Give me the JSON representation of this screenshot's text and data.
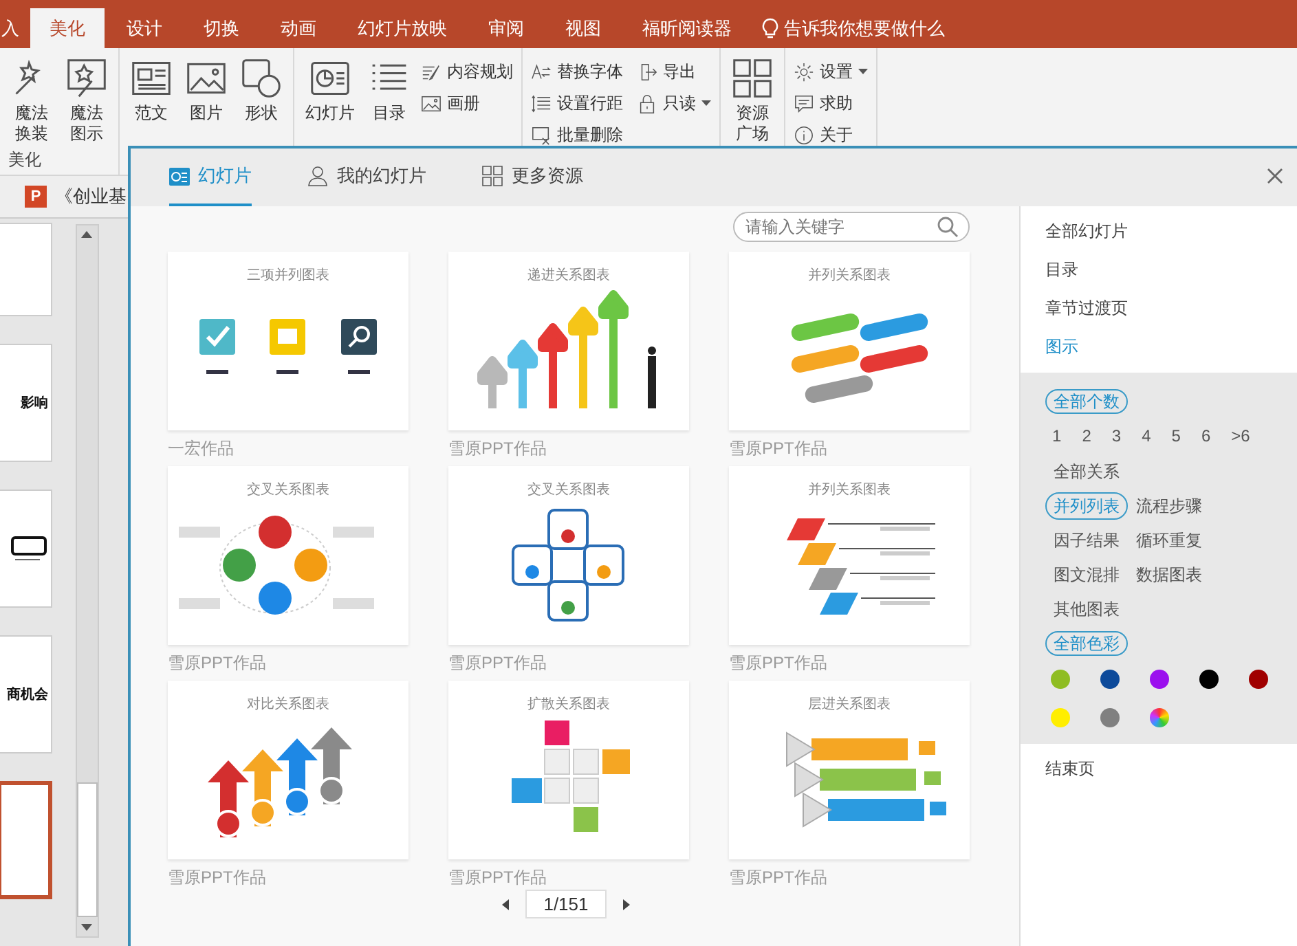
{
  "ribbon_tabs": [
    {
      "label": "入",
      "selected": false
    },
    {
      "label": "美化",
      "selected": true
    },
    {
      "label": "设计",
      "selected": false
    },
    {
      "label": "切换",
      "selected": false
    },
    {
      "label": "动画",
      "selected": false
    },
    {
      "label": "幻灯片放映",
      "selected": false
    },
    {
      "label": "审阅",
      "selected": false
    },
    {
      "label": "视图",
      "selected": false
    },
    {
      "label": "福昕阅读器",
      "selected": false
    }
  ],
  "tell_me": "告诉我你想要做什么",
  "ribbon_groups": [
    {
      "label": "美化",
      "large": [
        {
          "label": "魔法换装",
          "kind": "wand"
        },
        {
          "label": "魔法图示",
          "kind": "wandframe"
        }
      ]
    },
    {
      "large": [
        {
          "label": "范文",
          "kind": "doc"
        },
        {
          "label": "图片",
          "kind": "picture"
        },
        {
          "label": "形状",
          "kind": "shapes"
        }
      ]
    },
    {
      "large": [
        {
          "label": "幻灯片",
          "kind": "slide"
        },
        {
          "label": "目录",
          "kind": "list"
        }
      ],
      "small": [
        {
          "label": "内容规划",
          "kind": "pen",
          "dropdown": false
        },
        {
          "label": "画册",
          "kind": "album",
          "dropdown": false
        }
      ]
    },
    {
      "small": [
        {
          "label": "替换字体",
          "kind": "font",
          "dropdown": false
        },
        {
          "label": "设置行距",
          "kind": "spacing",
          "dropdown": false
        },
        {
          "label": "批量删除",
          "kind": "delete",
          "dropdown": false
        },
        {
          "label": "导出",
          "kind": "export",
          "dropdown": false
        },
        {
          "label": "只读",
          "kind": "lock",
          "dropdown": true
        }
      ]
    },
    {
      "large": [
        {
          "label": "资源广场",
          "kind": "grid"
        }
      ]
    },
    {
      "small": [
        {
          "label": "设置",
          "kind": "gear",
          "dropdown": true
        },
        {
          "label": "求助",
          "kind": "help",
          "dropdown": false
        },
        {
          "label": "关于",
          "kind": "info",
          "dropdown": false
        }
      ]
    }
  ],
  "document_badge": "P",
  "document_tab": "《创业基",
  "slides": [
    {
      "kind": "blank",
      "selected": false
    },
    {
      "kind": "title",
      "title": "影响",
      "selected": false
    },
    {
      "kind": "diagram",
      "selected": false
    },
    {
      "kind": "title",
      "title": "商机会",
      "selected": false
    },
    {
      "kind": "blank",
      "selected": true
    }
  ],
  "dialog": {
    "tabs": [
      {
        "label": "幻灯片",
        "kind": "slide",
        "selected": true
      },
      {
        "label": "我的幻灯片",
        "kind": "person",
        "selected": false
      },
      {
        "label": "更多资源",
        "kind": "grid",
        "selected": false
      }
    ],
    "search": {
      "placeholder": "请输入关键字"
    },
    "cards": [
      {
        "title": "三项并列图表",
        "kind": "icons",
        "author": "一宏作品"
      },
      {
        "title": "递进关系图表",
        "kind": "stairs",
        "author": "雪原PPT作品"
      },
      {
        "title": "并列关系图表",
        "kind": "pills",
        "author": "雪原PPT作品"
      },
      {
        "title": "交叉关系图表",
        "kind": "circles",
        "author": "雪原PPT作品"
      },
      {
        "title": "交叉关系图表",
        "kind": "cross",
        "author": "雪原PPT作品"
      },
      {
        "title": "并列关系图表",
        "kind": "steps",
        "author": "雪原PPT作品"
      },
      {
        "title": "对比关系图表",
        "kind": "arrows",
        "author": "雪原PPT作品"
      },
      {
        "title": "扩散关系图表",
        "kind": "spread",
        "author": "雪原PPT作品"
      },
      {
        "title": "层进关系图表",
        "kind": "layers",
        "author": "雪原PPT作品"
      }
    ],
    "page": "1/151",
    "categories": [
      {
        "label": "全部幻灯片",
        "selected": false
      },
      {
        "label": "目录",
        "selected": false
      },
      {
        "label": "章节过渡页",
        "selected": false
      },
      {
        "label": "图示",
        "selected": true
      }
    ],
    "counts": {
      "all": {
        "label": "全部个数",
        "selected": true
      },
      "items": [
        {
          "label": "1",
          "selected": false
        },
        {
          "label": "2",
          "selected": false
        },
        {
          "label": "3",
          "selected": false
        },
        {
          "label": "4",
          "selected": false
        },
        {
          "label": "5",
          "selected": false
        },
        {
          "label": "6",
          "selected": false
        },
        {
          "label": ">6",
          "selected": false
        }
      ]
    },
    "relations": {
      "all": {
        "label": "全部关系",
        "selected": false
      },
      "items": [
        {
          "label": "并列列表",
          "selected": true
        },
        {
          "label": "流程步骤",
          "selected": false
        },
        {
          "label": "因子结果",
          "selected": false
        },
        {
          "label": "循环重复",
          "selected": false
        },
        {
          "label": "图文混排",
          "selected": false
        },
        {
          "label": "数据图表",
          "selected": false
        },
        {
          "label": "其他图表",
          "selected": false
        }
      ]
    },
    "colors": {
      "all": {
        "label": "全部色彩",
        "selected": true
      },
      "swatches": [
        {
          "kind": "solid",
          "color": "#8fbd22"
        },
        {
          "kind": "solid",
          "color": "#0d4a9a"
        },
        {
          "kind": "solid",
          "color": "#9b10ee"
        },
        {
          "kind": "solid",
          "color": "#000000"
        },
        {
          "kind": "solid",
          "color": "#a00000"
        },
        {
          "kind": "solid",
          "color": "#ffee00"
        },
        {
          "kind": "solid",
          "color": "#808080"
        },
        {
          "kind": "multi"
        }
      ]
    },
    "end_categories": [
      {
        "label": "结束页",
        "selected": false
      }
    ]
  }
}
